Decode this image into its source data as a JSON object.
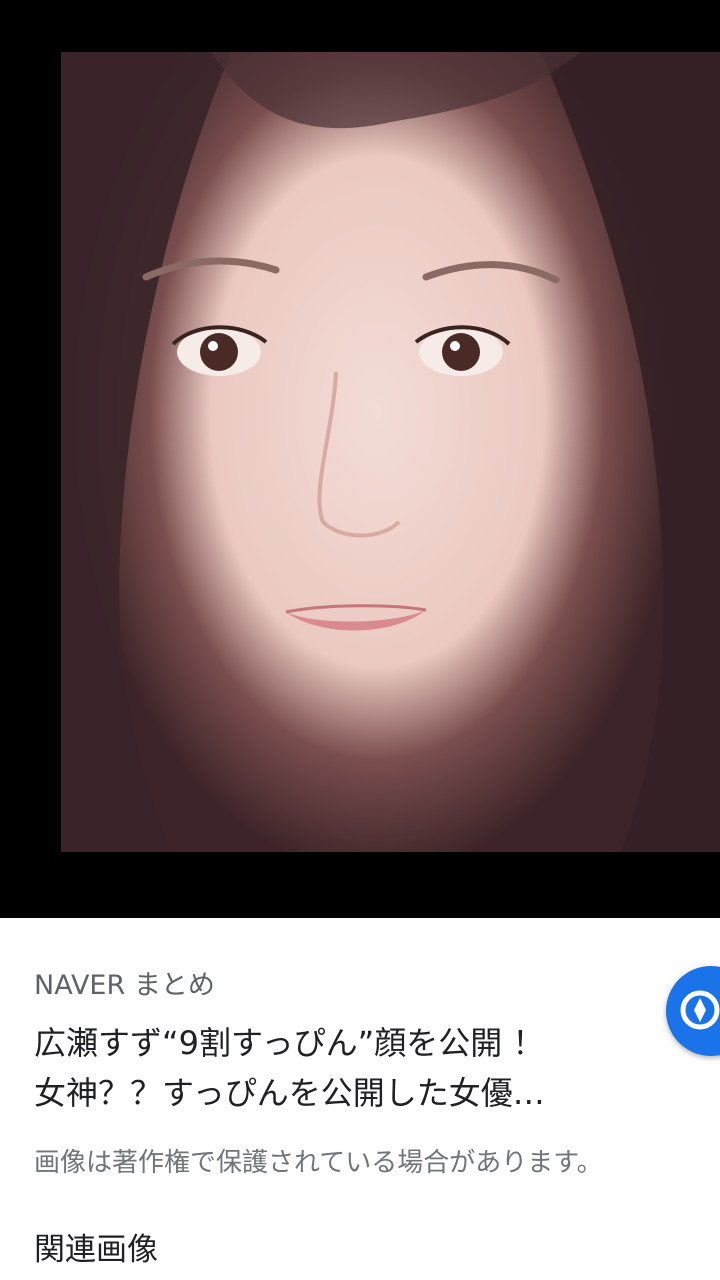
{
  "image": {
    "alt_icon": "portrait-photo"
  },
  "result": {
    "source": "NAVER まとめ",
    "title_line1": "広瀬すず“9割すっぴん”顔を公開 ！",
    "title_line2": "女神？？すっぴんを公開した女優…",
    "copyright_notice": "画像は著作権で保護されている場合があります。",
    "visit_icon": "compass-icon",
    "accent_color": "#1a73e8"
  },
  "related": {
    "heading": "関連画像"
  }
}
